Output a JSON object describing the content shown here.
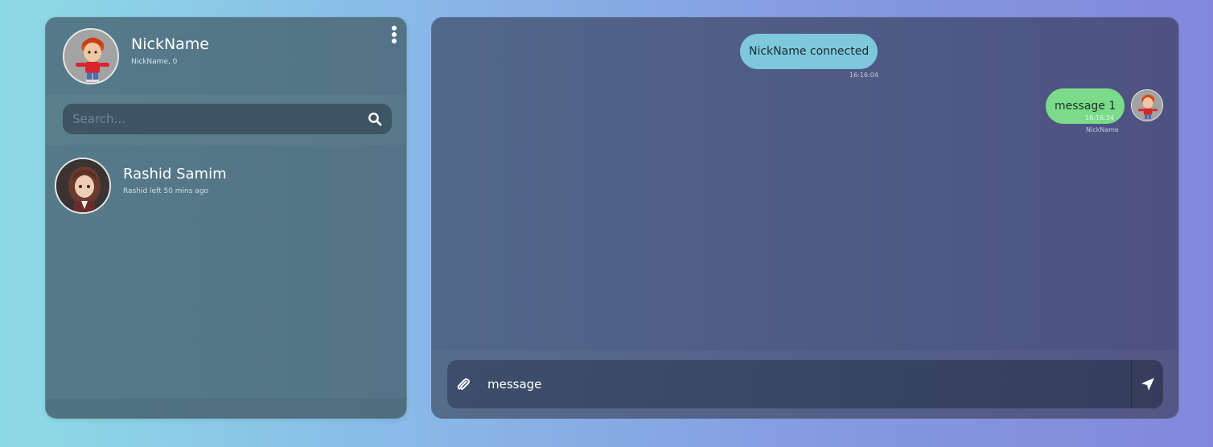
{
  "sidebar": {
    "profile": {
      "name": "NickName",
      "subtitle": "NickName, 0",
      "avatar": "cartoon-boy-avatar"
    },
    "menu_icon": "kebab-menu-icon",
    "search": {
      "placeholder": "Search...",
      "value": "",
      "icon": "search-icon"
    },
    "contacts": [
      {
        "name": "Rashid Samim",
        "status": "Rashid left 50 mins ago",
        "avatar": "cartoon-girl-avatar"
      }
    ]
  },
  "chat": {
    "messages": [
      {
        "type": "system",
        "text": "NickName connected",
        "time": "16:16:04"
      },
      {
        "type": "outgoing",
        "text": "message 1",
        "time": "16:16:34",
        "sender": "NickName"
      }
    ],
    "composer": {
      "value": "message",
      "attach_icon": "paperclip-icon",
      "send_icon": "send-arrow-icon"
    }
  },
  "colors": {
    "system_bubble": "#7ec8dc",
    "outgoing_bubble": "#7bdb8b"
  }
}
